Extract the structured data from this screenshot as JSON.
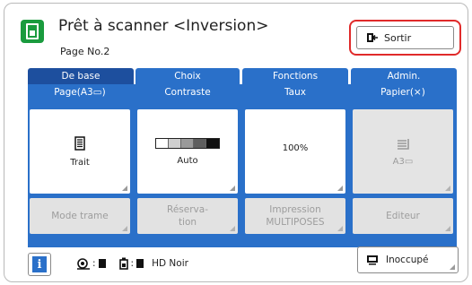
{
  "header": {
    "title": "Prêt à scanner <Inversion>",
    "subtitle": "Page No.2",
    "exit_label": "Sortir"
  },
  "tabs": [
    {
      "label": "De base",
      "active": true
    },
    {
      "label": "Choix",
      "active": false
    },
    {
      "label": "Fonctions",
      "active": false
    },
    {
      "label": "Admin.",
      "active": false
    }
  ],
  "columns": [
    {
      "label": "Page(A3▭)",
      "value": "Trait",
      "icon": "document-icon",
      "enabled": true
    },
    {
      "label": "Contraste",
      "value": "Auto",
      "icon": "contrast-scale-icon",
      "enabled": true
    },
    {
      "label": "Taux",
      "value": "100%",
      "icon": "",
      "enabled": true
    },
    {
      "label": "Papier(⨯)",
      "value": "A3▭",
      "icon": "paper-tray-icon",
      "enabled": false
    }
  ],
  "function_buttons": [
    {
      "label": "Mode trame",
      "enabled": false
    },
    {
      "label": "Réserva-\ntion",
      "enabled": false
    },
    {
      "label": "Impression\nMULTIPOSES",
      "enabled": false
    },
    {
      "label": "Editeur",
      "enabled": false
    }
  ],
  "status_bar": {
    "info_label": "i",
    "sep1": ":",
    "sep2": ":",
    "mode_text": "HD Noir",
    "busy_label": "Inoccupé"
  },
  "colors": {
    "accent": "#2a70c9",
    "tab_active": "#1d4f9e",
    "app_icon": "#1a9b3e",
    "highlight": "#e02a2a"
  }
}
